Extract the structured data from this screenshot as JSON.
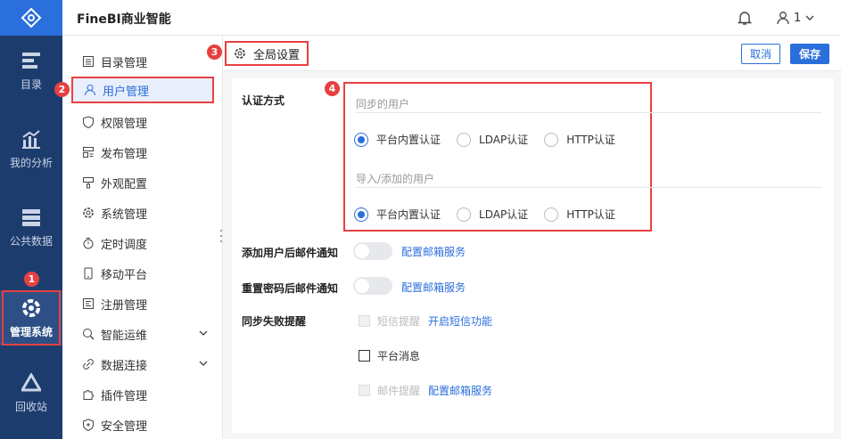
{
  "app": {
    "title": "FineBI商业智能"
  },
  "user": {
    "name": "1"
  },
  "rail": [
    {
      "id": "catalog",
      "label": "目录",
      "icon": "catalog-icon"
    },
    {
      "id": "analysis",
      "label": "我的分析",
      "icon": "analysis-icon"
    },
    {
      "id": "public",
      "label": "公共数据",
      "icon": "database-icon"
    },
    {
      "id": "system",
      "label": "管理系统",
      "icon": "system-gear-icon",
      "active": true
    },
    {
      "id": "recycle",
      "label": "回收站",
      "icon": "recycle-icon"
    }
  ],
  "menu": [
    {
      "label": "目录管理",
      "icon": "list-icon"
    },
    {
      "label": "用户管理",
      "icon": "user-icon",
      "active": true
    },
    {
      "label": "权限管理",
      "icon": "shield-icon"
    },
    {
      "label": "发布管理",
      "icon": "publish-icon"
    },
    {
      "label": "外观配置",
      "icon": "brush-icon"
    },
    {
      "label": "系统管理",
      "icon": "gear-icon"
    },
    {
      "label": "定时调度",
      "icon": "timer-icon"
    },
    {
      "label": "移动平台",
      "icon": "mobile-icon"
    },
    {
      "label": "注册管理",
      "icon": "register-icon"
    },
    {
      "label": "智能运维",
      "icon": "ops-icon",
      "expandable": true
    },
    {
      "label": "数据连接",
      "icon": "link-icon",
      "expandable": true
    },
    {
      "label": "插件管理",
      "icon": "plugin-icon"
    },
    {
      "label": "安全管理",
      "icon": "security-icon"
    }
  ],
  "tab": {
    "label": "全局设置"
  },
  "actions": {
    "cancel": "取消",
    "save": "保存"
  },
  "auth": {
    "label": "认证方式",
    "sync_title": "同步的用户",
    "import_title": "导入/添加的用户",
    "options": [
      "平台内置认证",
      "LDAP认证",
      "HTTP认证"
    ],
    "sync_selected": 0,
    "import_selected": 0
  },
  "mail_on_add": {
    "label": "添加用户后邮件通知",
    "link": "配置邮箱服务",
    "enabled": false
  },
  "mail_on_reset": {
    "label": "重置密码后邮件通知",
    "link": "配置邮箱服务",
    "enabled": false
  },
  "sync_fail": {
    "label": "同步失败提醒",
    "sms": {
      "text": "短信提醒",
      "link": "开启短信功能",
      "disabled": true
    },
    "platform": {
      "text": "平台消息",
      "disabled": false
    },
    "mail": {
      "text": "邮件提醒",
      "link": "配置邮箱服务",
      "disabled": true
    }
  },
  "badges": [
    "1",
    "2",
    "3",
    "4"
  ],
  "colors": {
    "accent": "#2a6fdb",
    "rail": "#1d3c6e",
    "highlight": "#e84040"
  }
}
